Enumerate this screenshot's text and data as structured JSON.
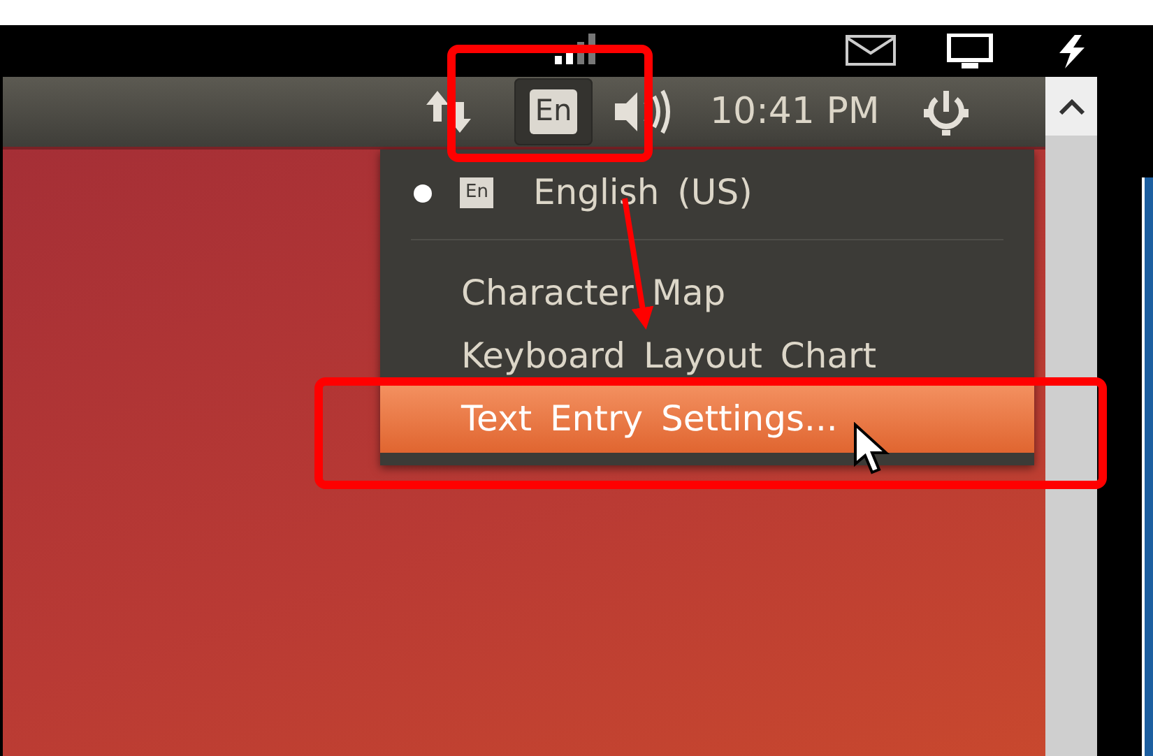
{
  "panel": {
    "language_indicator": {
      "label": "En",
      "selected": true
    },
    "clock": "10:41 PM"
  },
  "menu": {
    "items": [
      {
        "kind": "radio",
        "label": "English (US)",
        "badge": "En",
        "selected": true
      },
      {
        "kind": "separator"
      },
      {
        "kind": "action",
        "label": "Character Map",
        "selected": false
      },
      {
        "kind": "action",
        "label": "Keyboard Layout Chart",
        "selected": false
      },
      {
        "kind": "action",
        "label": "Text Entry Settings...",
        "selected": true
      }
    ]
  }
}
